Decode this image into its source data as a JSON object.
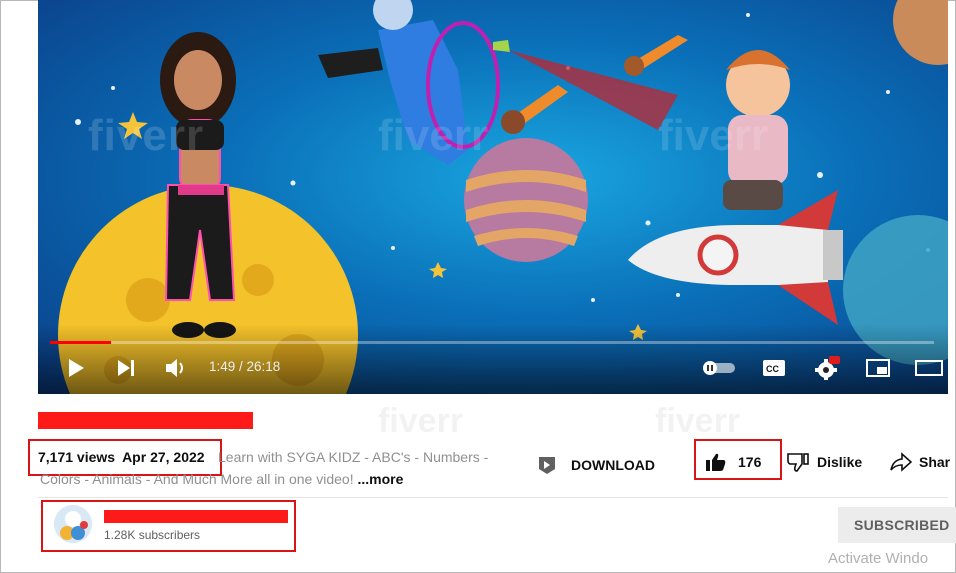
{
  "player": {
    "time_current": "1:49",
    "time_total": "26:18",
    "time_display": "1:49 / 26:18",
    "progress_fraction": 0.069,
    "watermark": "fiverr",
    "hd_badge": "HD",
    "icons": [
      "play-icon",
      "next-icon",
      "volume-icon",
      "autoplay-toggle-icon",
      "captions-icon",
      "settings-icon",
      "miniplayer-icon",
      "theater-icon"
    ]
  },
  "video": {
    "views": "7,171 views",
    "date": "Apr 27, 2022",
    "description_line1": "Learn with SYGA KIDZ - ABC's - Numbers -",
    "description_line2": "Colors - Animals - And Much More all in one video!",
    "more_label": "...more"
  },
  "actions": {
    "download_label": "DOWNLOAD",
    "like_count": "176",
    "dislike_label": "Dislike",
    "share_label": "Shar"
  },
  "channel": {
    "subscribers": "1.28K subscribers",
    "subscribed_label": "SUBSCRIBED"
  },
  "overlay": {
    "activate_text": "Activate Windo"
  },
  "colors": {
    "annotation_red": "#d71515",
    "redaction_red": "#ff1a1a",
    "progress_red": "#ff0000"
  }
}
